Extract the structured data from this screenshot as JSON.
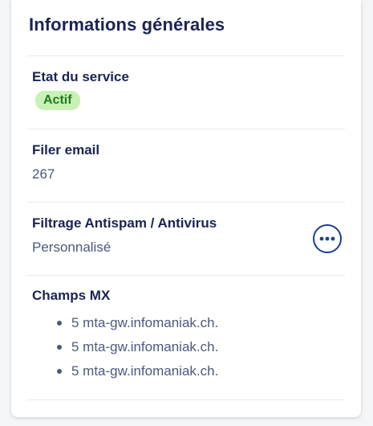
{
  "card": {
    "title": "Informations générales"
  },
  "service_state": {
    "label": "Etat du service",
    "status": "Actif",
    "status_color": "#c8f2b4"
  },
  "filer_email": {
    "label": "Filer email",
    "value": "267"
  },
  "antispam": {
    "label": "Filtrage Antispam / Antivirus",
    "value": "Personnalisé",
    "action_icon": "more-horizontal-icon"
  },
  "mx": {
    "label": "Champs MX",
    "records": [
      "5 mta-gw.infomaniak.ch.",
      "5 mta-gw.infomaniak.ch.",
      "5 mta-gw.infomaniak.ch."
    ]
  },
  "colors": {
    "heading": "#1a2453",
    "text_muted": "#4e587c",
    "accent": "#1a3f8f"
  }
}
